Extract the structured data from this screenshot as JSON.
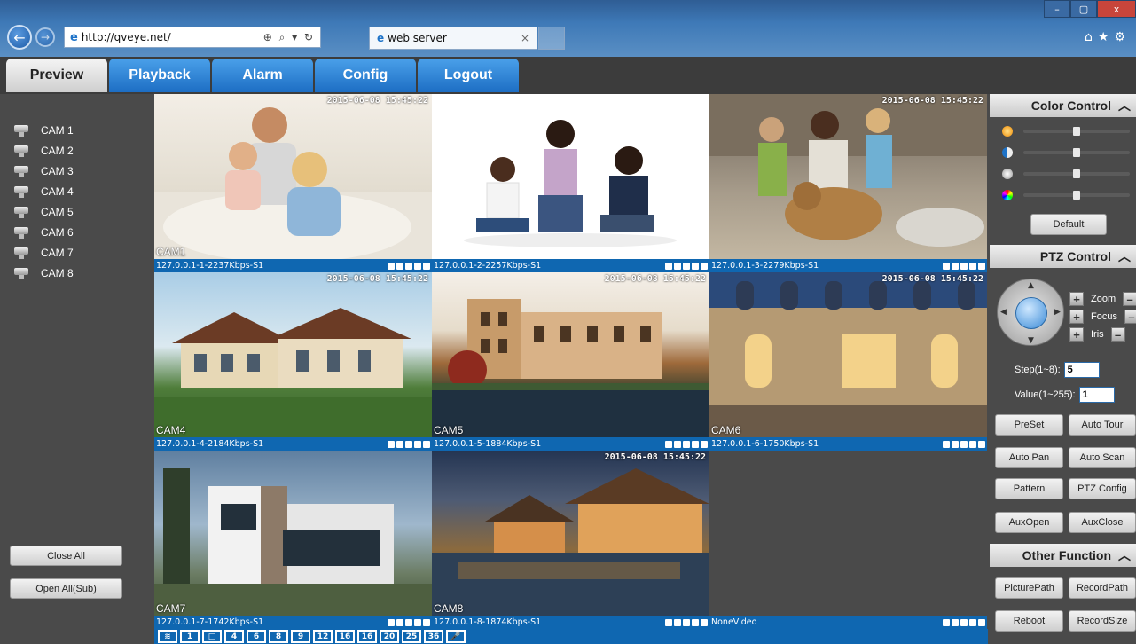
{
  "browser": {
    "address": "http://qveye.net/",
    "tab_title": "web server",
    "close_tab": "×",
    "window_controls": [
      "–",
      "▢",
      "x"
    ]
  },
  "tabs": [
    {
      "label": "Preview",
      "active": true
    },
    {
      "label": "Playback",
      "active": false
    },
    {
      "label": "Alarm",
      "active": false
    },
    {
      "label": "Config",
      "active": false
    },
    {
      "label": "Logout",
      "active": false
    }
  ],
  "cameras": [
    "CAM 1",
    "CAM 2",
    "CAM 3",
    "CAM 4",
    "CAM 5",
    "CAM 6",
    "CAM 7",
    "CAM 8"
  ],
  "left_buttons": {
    "close_all": "Close All",
    "open_all": "Open All(Sub)"
  },
  "cells": [
    {
      "label": "CAM1",
      "info": "127.0.0.1-1-2237Kbps-S1",
      "timestamp": "2015-06-08 15:45:22"
    },
    {
      "label": "",
      "info": "127.0.0.1-2-2257Kbps-S1",
      "timestamp": ""
    },
    {
      "label": "",
      "info": "127.0.0.1-3-2279Kbps-S1",
      "timestamp": "2015-06-08 15:45:22"
    },
    {
      "label": "CAM4",
      "info": "127.0.0.1-4-2184Kbps-S1",
      "timestamp": "2015-06-08 15:45:22"
    },
    {
      "label": "CAM5",
      "info": "127.0.0.1-5-1884Kbps-S1",
      "timestamp": "2015-06-08 15:45:22"
    },
    {
      "label": "CAM6",
      "info": "127.0.0.1-6-1750Kbps-S1",
      "timestamp": "2015-06-08 15:45:22"
    },
    {
      "label": "CAM7",
      "info": "127.0.0.1-7-1742Kbps-S1",
      "timestamp": ""
    },
    {
      "label": "CAM8",
      "info": "127.0.0.1-8-1874Kbps-S1",
      "timestamp": "2015-06-08 15:45:22"
    },
    {
      "label": "",
      "info": "NoneVideo",
      "timestamp": ""
    }
  ],
  "layout_buttons": [
    "≋",
    "1",
    "□",
    "4",
    "6",
    "8",
    "9",
    "12",
    "16",
    "16",
    "20",
    "25",
    "36",
    "🎤"
  ],
  "color_control": {
    "title": "Color Control",
    "levels": [
      0.5,
      0.5,
      0.5,
      0.5
    ],
    "default_label": "Default"
  },
  "ptz_control": {
    "title": "PTZ Control",
    "zoom": "Zoom",
    "focus": "Focus",
    "iris": "Iris",
    "step_label": "Step(1~8):",
    "step_value": "5",
    "value_label": "Value(1~255):",
    "value_value": "1",
    "buttons": [
      "PreSet",
      "Auto Tour",
      "Auto Pan",
      "Auto Scan",
      "Pattern",
      "PTZ Config",
      "AuxOpen",
      "AuxClose"
    ]
  },
  "other_function": {
    "title": "Other Function",
    "buttons": [
      "PicturePath",
      "RecordPath",
      "Reboot",
      "RecordSize"
    ]
  }
}
